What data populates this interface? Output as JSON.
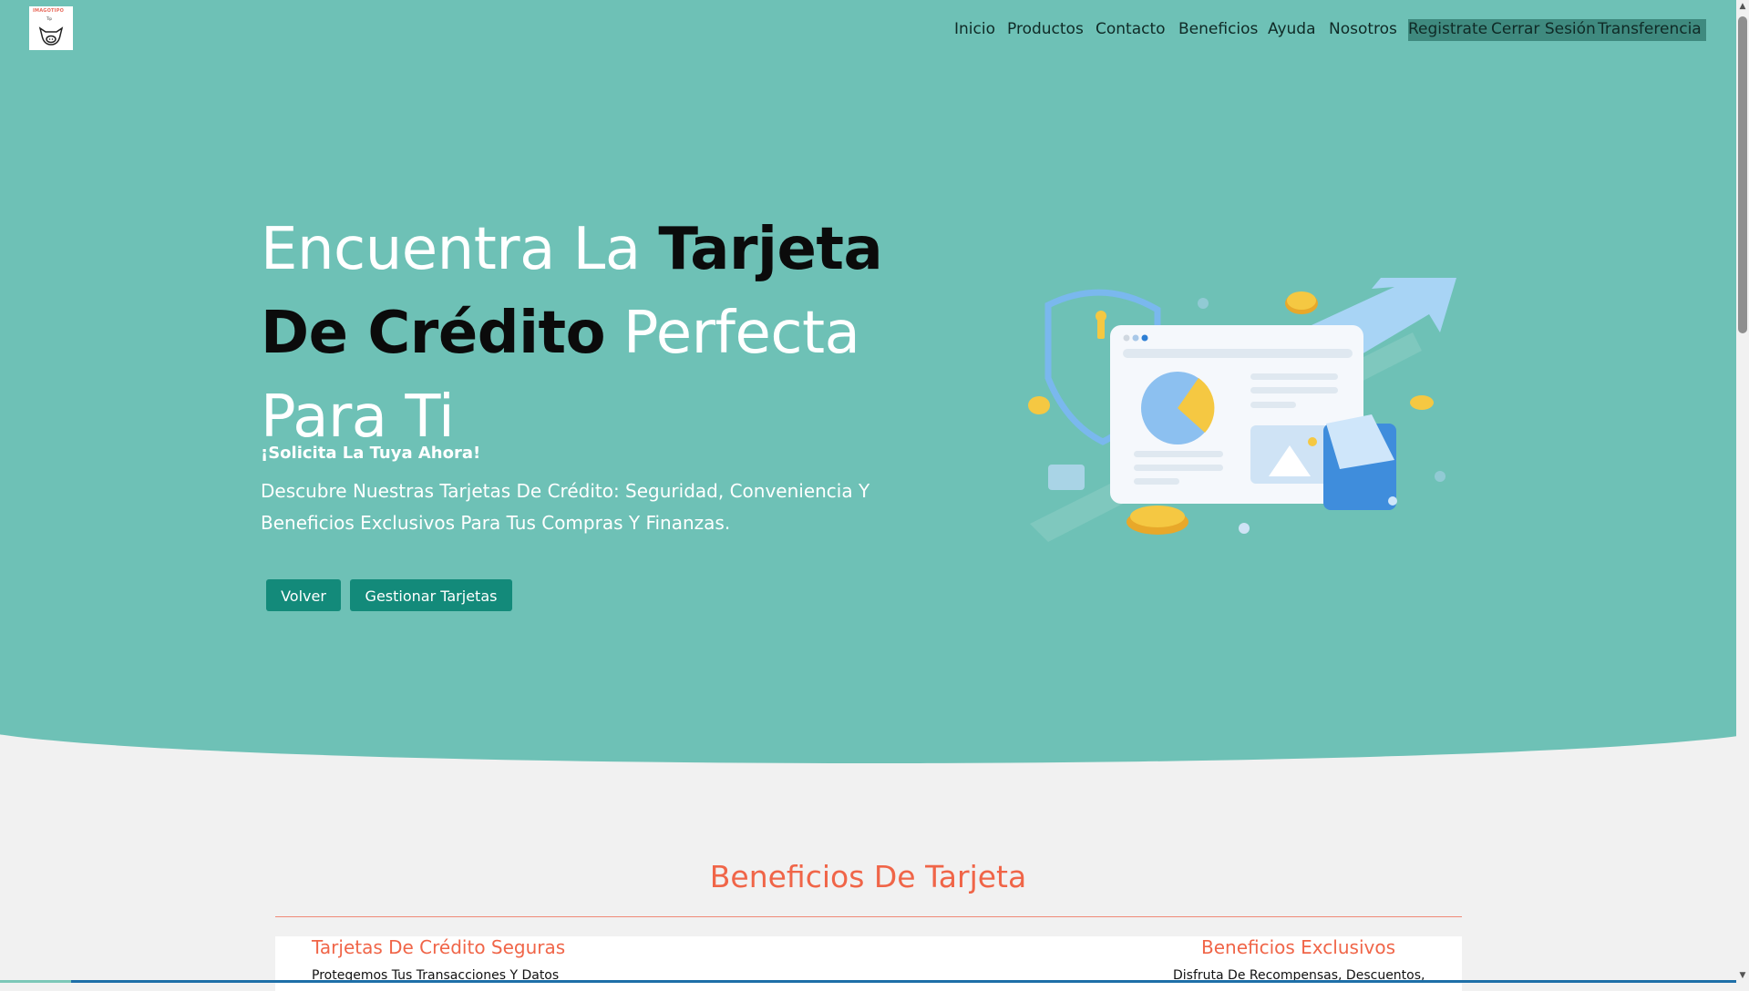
{
  "logo": {
    "text": "IMAGOTIPO",
    "sub": "Tip"
  },
  "nav": {
    "items": [
      "Inicio",
      "Productos",
      "Contacto",
      "Beneficios",
      "Ayuda",
      "Nosotros",
      "Registrate",
      "Cerrar Sesión",
      "Transferencia"
    ]
  },
  "hero": {
    "title_1": "Encuentra La ",
    "title_2": "Tarjeta",
    "title_3": "De Crédito",
    "title_4": " Perfecta",
    "title_5": "Para Ti",
    "subtitle": "¡Solicita La Tuya Ahora!",
    "description": "Descubre Nuestras Tarjetas De Crédito: Seguridad, Conveniencia Y Beneficios Exclusivos Para Tus Compras Y Finanzas.",
    "buttons": {
      "back": "Volver",
      "manage": "Gestionar Tarjetas"
    }
  },
  "benefits": {
    "title": "Beneficios De Tarjeta",
    "cards": [
      {
        "title": "Tarjetas De Crédito Seguras",
        "text": "Protegemos Tus Transacciones Y Datos"
      },
      {
        "title": "Beneficios Exclusivos",
        "text": "Disfruta De Recompensas, Descuentos,"
      }
    ]
  },
  "colors": {
    "hero_bg": "#6ec1b6",
    "button": "#138a7a",
    "accent": "#f06548",
    "page_bg": "#f1f1f1"
  }
}
